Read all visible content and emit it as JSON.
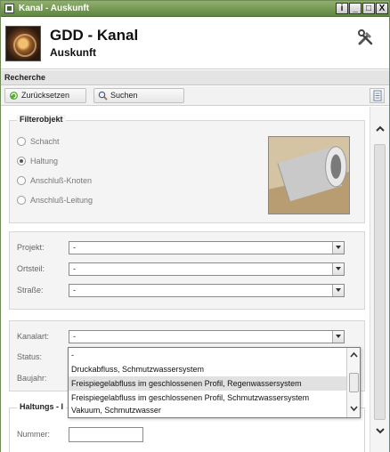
{
  "window": {
    "title": "Kanal - Auskunft",
    "buttons": [
      "i",
      "_",
      "□",
      "X"
    ]
  },
  "header": {
    "title": "GDD - Kanal",
    "subtitle": "Auskunft",
    "logo_icon": "sewer-pipe-logo",
    "tools_icon": "tools-icon"
  },
  "section": {
    "title": "Recherche"
  },
  "toolbar": {
    "reset_label": "Zurücksetzen",
    "search_label": "Suchen"
  },
  "filterobjekt": {
    "legend": "Filterobjekt",
    "options": [
      {
        "label": "Schacht",
        "selected": false
      },
      {
        "label": "Haltung",
        "selected": true
      },
      {
        "label": "Anschluß-Knoten",
        "selected": false
      },
      {
        "label": "Anschluß-Leitung",
        "selected": false
      }
    ]
  },
  "location": {
    "fields": [
      {
        "label": "Projekt:",
        "value": "-"
      },
      {
        "label": "Ortsteil:",
        "value": "-"
      },
      {
        "label": "Straße:",
        "value": "-"
      }
    ]
  },
  "attributes": {
    "kanalart_label": "Kanalart:",
    "kanalart_value": "-",
    "status_label": "Status:",
    "baujahr_label": "Baujahr:"
  },
  "dropdown": {
    "items": [
      "-",
      "Druckabfluss, Schmutzwassersystem",
      "Freispiegelabfluss im geschlossenen Profil, Regenwassersystem",
      "Freispiegelabfluss im geschlossenen Profil, Schmutzwassersystem",
      "Vakuum, Schmutzwasser"
    ],
    "highlighted_index": 2
  },
  "haltung": {
    "legend": "Haltungs - I",
    "nummer_label": "Nummer:",
    "nummer_value": ""
  }
}
